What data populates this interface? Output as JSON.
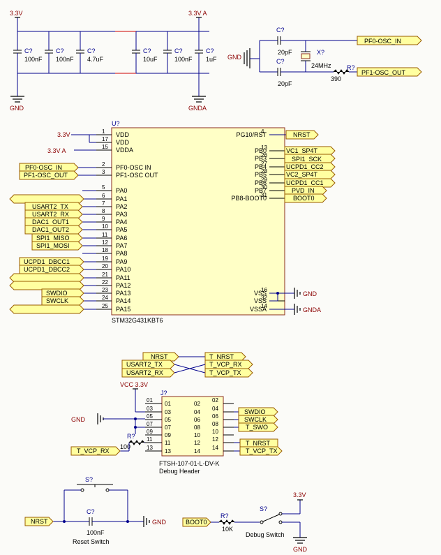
{
  "power": {
    "v33": "3.3V",
    "v33a": "3.3V A",
    "gnd": "GND",
    "gnda": "GNDA",
    "vcc33": "VCC 3.3V"
  },
  "decoupling": {
    "refs": [
      "C?",
      "C?",
      "C?",
      "C?",
      "C?",
      "C?"
    ],
    "values": [
      "100nF",
      "100nF",
      "4.7uF",
      "10uF",
      "100nF",
      "1uF"
    ]
  },
  "oscillator": {
    "c1_ref": "C?",
    "c1_val": "20pF",
    "c2_ref": "C?",
    "c2_val": "20pF",
    "x_ref": "X?",
    "x_val": "24MHz",
    "r_ref": "R?",
    "r_val": "390",
    "port_in": "PF0-OSC_IN",
    "port_out": "PF1-OSC_OUT",
    "gnd": "GND"
  },
  "mcu": {
    "ref": "U?",
    "part": "STM32G431KBT6",
    "left_pins": [
      {
        "num": "1",
        "name": "VDD"
      },
      {
        "num": "17",
        "name": "VDD"
      },
      {
        "num": "15",
        "name": "VDDA"
      },
      {
        "num": "2",
        "name": "PF0-OSC IN"
      },
      {
        "num": "3",
        "name": "PF1-OSC OUT"
      },
      {
        "num": "5",
        "name": "PA0"
      },
      {
        "num": "6",
        "name": "PA1"
      },
      {
        "num": "7",
        "name": "PA2"
      },
      {
        "num": "8",
        "name": "PA3"
      },
      {
        "num": "9",
        "name": "PA4"
      },
      {
        "num": "10",
        "name": "PA5"
      },
      {
        "num": "11",
        "name": "PA6"
      },
      {
        "num": "12",
        "name": "PA7"
      },
      {
        "num": "18",
        "name": "PA8"
      },
      {
        "num": "19",
        "name": "PA9"
      },
      {
        "num": "20",
        "name": "PA10"
      },
      {
        "num": "21",
        "name": "PA11"
      },
      {
        "num": "22",
        "name": "PA12"
      },
      {
        "num": "23",
        "name": "PA13"
      },
      {
        "num": "24",
        "name": "PA14"
      },
      {
        "num": "25",
        "name": "PA15"
      }
    ],
    "right_pins": [
      {
        "num": "4",
        "name": "PG10/RST"
      },
      {
        "num": "13",
        "name": "PB0"
      },
      {
        "num": "26",
        "name": "PB3"
      },
      {
        "num": "27",
        "name": "PB4"
      },
      {
        "num": "28",
        "name": "PB5"
      },
      {
        "num": "29",
        "name": "PB6"
      },
      {
        "num": "30",
        "name": "PB7"
      },
      {
        "num": "31",
        "name": "PB8-BOOT0"
      },
      {
        "num": "16",
        "name": "VSS"
      },
      {
        "num": "32",
        "name": "VSS"
      },
      {
        "num": "14",
        "name": "VSSA"
      }
    ],
    "left_nets": {
      "vdd": "3.3V",
      "vdda": "3.3V A",
      "pf0": "PF0-OSC_IN",
      "pf1": "PF1-OSC_OUT",
      "pa2": "USART2_TX",
      "pa3": "USART2_RX",
      "pa4": "DAC1_OUT1",
      "pa5": "DAC1_OUT2",
      "pa6": "SPI1_MISO",
      "pa7": "SPI1_MOSI",
      "pa9": "UCPD1_DBCC1",
      "pa10": "UCPD1_DBCC2",
      "pa13": "SWDIO",
      "pa14": "SWCLK"
    },
    "right_nets": {
      "nrst": "NRST",
      "pb0": "VC1_SP4T",
      "pb3": "SPI1_SCK",
      "pb4": "UCPD1_CC2",
      "pb5": "VC2_SP4T",
      "pb6": "UCPD1_CC1",
      "pb7": "PVD_IN",
      "boot0": "BOOT0",
      "gnd": "GND",
      "gnda": "GNDA"
    }
  },
  "debug_map": {
    "left": [
      "NRST",
      "USART2_TX",
      "USART2_RX"
    ],
    "right": [
      "T_NRST",
      "T_VCP_RX",
      "T_VCP_TX"
    ]
  },
  "header": {
    "ref": "J?",
    "part": "FTSH-107-01-L-DV-K",
    "title": "Debug Header",
    "left_pins": [
      "01",
      "03",
      "05",
      "07",
      "09",
      "11",
      "13"
    ],
    "right_pins": [
      "02",
      "04",
      "06",
      "08",
      "10",
      "12",
      "14"
    ],
    "body_left": [
      "01",
      "03",
      "05",
      "07",
      "09",
      "11",
      "13"
    ],
    "body_right": [
      "02",
      "04",
      "06",
      "08",
      "10",
      "12",
      "14"
    ],
    "nets_right": [
      "SWDIO",
      "SWCLK",
      "T_SWO",
      "T_NRST",
      "T_VCP_TX"
    ],
    "net_left": "T_VCP_RX",
    "r_ref": "R?",
    "r_val": "100",
    "gnd": "GND"
  },
  "reset": {
    "sw_ref": "S?",
    "c_ref": "C?",
    "c_val": "100nF",
    "title": "Reset Switch",
    "net": "NRST",
    "gnd": "GND"
  },
  "boot": {
    "net": "BOOT0",
    "r_ref": "R?",
    "r_val": "10K",
    "sw_ref": "S?",
    "title": "Debug Switch",
    "v": "3.3V",
    "gnd": "GND"
  }
}
